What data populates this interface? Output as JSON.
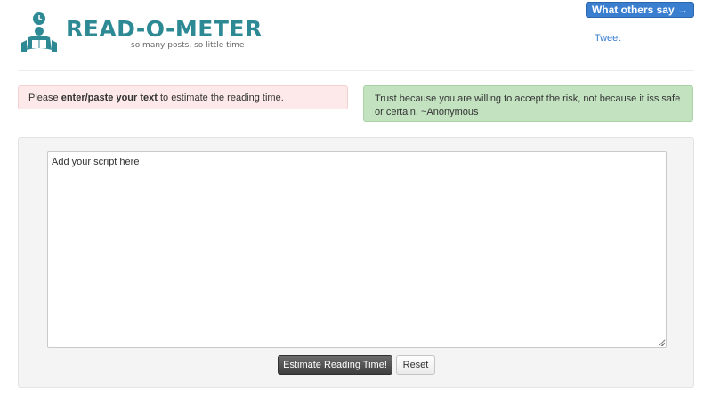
{
  "header": {
    "logo_title": "READ-O-METER",
    "logo_tagline": "so many posts, so little time",
    "logo_icon": "reader-with-clock-icon",
    "others_button": "What others say →",
    "tweet_link": "Tweet"
  },
  "alerts": {
    "instruction_prefix": "Please ",
    "instruction_bold": "enter/paste your text",
    "instruction_suffix": " to estimate the reading time.",
    "quote": "Trust because you are willing to accept the risk, not because it iss safe or certain. ~Anonymous"
  },
  "form": {
    "script_placeholder": "Add your script here",
    "estimate_button": "Estimate Reading Time!",
    "reset_button": "Reset"
  },
  "colors": {
    "brand": "#2d8a95",
    "primary_button": "#3a7ed0",
    "error_bg": "#fde9e9",
    "success_bg": "#c2e2c0"
  }
}
